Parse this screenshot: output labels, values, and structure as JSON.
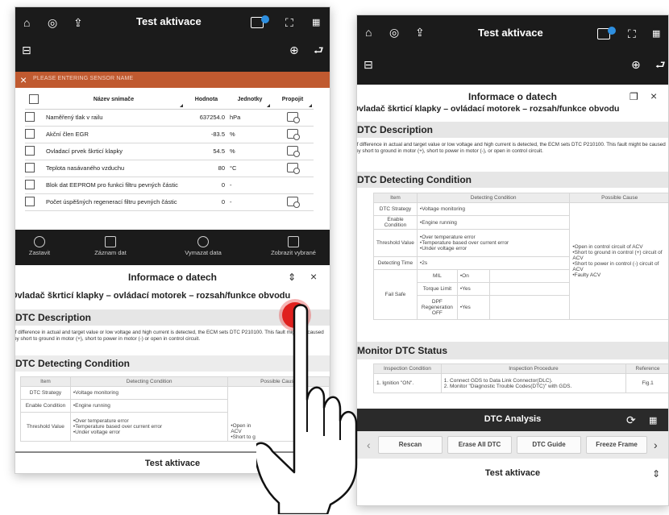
{
  "left_screen": {
    "title": "Test aktivace",
    "search_placeholder": "PLEASE ENTERING SENSOR NAME",
    "columns": [
      "Název snímače",
      "Hodnota",
      "Jednotky",
      "Propojit"
    ],
    "rows": [
      {
        "name": "Naměřený tlak v railu",
        "value": "637254.0",
        "unit": "hPa",
        "link": true
      },
      {
        "name": "Akční člen EGR",
        "value": "-83.5",
        "unit": "%",
        "link": true
      },
      {
        "name": "Ovladací prvek škrticí klapky",
        "value": "54.5",
        "unit": "%",
        "link": true
      },
      {
        "name": "Teplota nasávaného vzduchu",
        "value": "80",
        "unit": "°C",
        "link": true
      },
      {
        "name": "Blok dat EEPROM pro funkci filtru pevných částic",
        "value": "0",
        "unit": "-",
        "link": false
      },
      {
        "name": "Počet úspěšných regenerací filtru pevných částic",
        "value": "0",
        "unit": "-",
        "link": true
      }
    ],
    "actions": [
      "Zastavit",
      "Záznam dat",
      "Vymazat data",
      "Zobrazit vybrané"
    ],
    "info_title": "Informace o datech",
    "dtc_title": "Ovladač škrticí klapky – ovládací motorek – rozsah/funkce obvodu",
    "dtc_description_head": "DTC Description",
    "dtc_description_text": "If difference in actual and target value or low voltage and high current is detected, the ECM sets DTC P210100. This fault might be caused by short to ground in motor (+), short to power in motor (-) or open in control circuit.",
    "detecting_head": "DTC Detecting Condition",
    "cond_headers": [
      "Item",
      "Detecting Condition",
      "Possible Cause"
    ],
    "cond_rows": [
      {
        "item": "DTC Strategy",
        "cond": "•Voltage monitoring"
      },
      {
        "item": "Enable Condition",
        "cond": "•Engine running"
      },
      {
        "item": "Threshold Value",
        "cond": "•Over temperature error\n•Temperature based over current error\n•Under voltage error"
      }
    ],
    "possible_cause_partial": "•Open in\nACV\n•Short to g",
    "bottom_title": "Test aktivace"
  },
  "right_screen": {
    "title": "Test aktivace",
    "info_title": "Informace o datech",
    "dtc_title": "Ovladač škrticí klapky – ovládací motorek – rozsah/funkce obvodu",
    "dtc_description_head": "DTC Description",
    "dtc_description_text": "If difference in actual and target value or low voltage and high current is detected, the ECM sets DTC P210100. This fault might be caused by short to ground in motor (+), short to power in motor (-), or open in control circuit.",
    "detecting_head": "DTC Detecting Condition",
    "cond_headers": [
      "Item",
      "Detecting Condition",
      "Possible Cause"
    ],
    "cond_rows": [
      {
        "item": "DTC Strategy",
        "cond": "•Voltage monitoring"
      },
      {
        "item": "Enable Condition",
        "cond": "•Engine running"
      },
      {
        "item": "Threshold Value",
        "cond": "•Over temperature error\n•Temperature based over current error\n•Under voltage error"
      },
      {
        "item": "Detecting Time",
        "cond": "•2s"
      }
    ],
    "fail_safe": {
      "item": "Fail Safe",
      "rows": [
        {
          "label": "MIL",
          "value": "•On"
        },
        {
          "label": "Torque Limit",
          "value": "•Yes"
        },
        {
          "label": "DPF Regeneration OFF",
          "value": "•Yes"
        }
      ]
    },
    "possible_cause": "•Open in control circuit of ACV\n•Short to ground in control (+) circuit of ACV\n•Short to power in control (-) circuit of ACV\n•Faulty ACV",
    "monitor_head": "Monitor DTC Status",
    "monitor_headers": [
      "Inspection Condition",
      "Inspection Procedure",
      "Reference"
    ],
    "monitor_row": {
      "condition": "1. Ignition \"ON\".",
      "procedure": "1. Connect GDS to Data Link Connector(DLC).\n2. Monitor \"Diagnostic Trouble Codes(DTC)\" with GDS.",
      "reference": "Fig.1"
    },
    "analysis_label": "DTC Analysis",
    "buttons": [
      "Rescan",
      "Erase All DTC",
      "DTC Guide",
      "Freeze Frame"
    ],
    "bottom_title": "Test aktivace"
  },
  "colors": {
    "accent": "#c05a30",
    "dark": "#1b1b1b",
    "section": "#e6e6e6",
    "tap": "#e0201e",
    "badge": "#2e8fe0"
  }
}
